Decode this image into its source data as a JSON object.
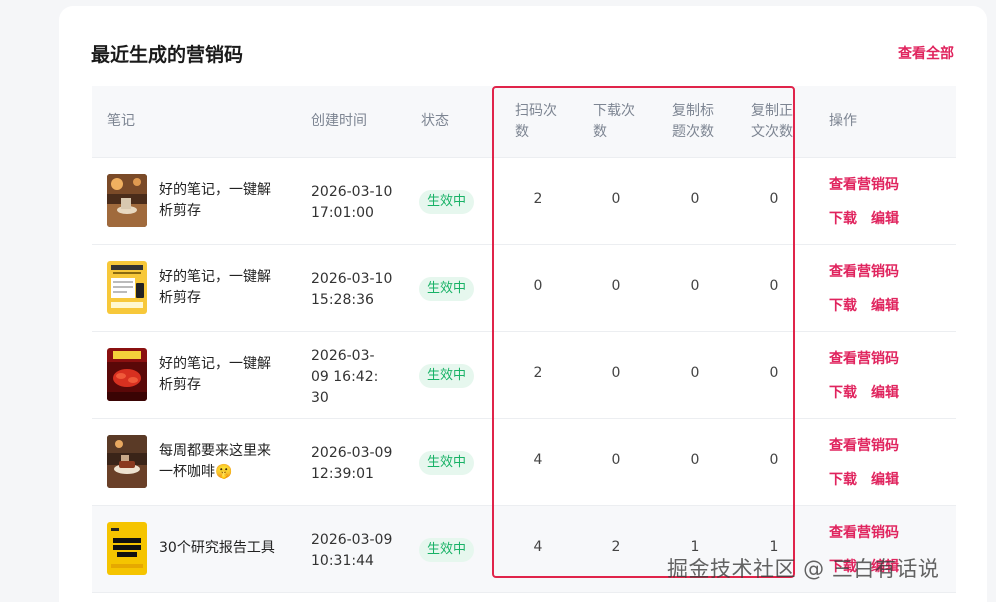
{
  "panel": {
    "title": "最近生成的营销码",
    "view_all": "查看全部"
  },
  "columns": {
    "note": "笔记",
    "created": "创建时间",
    "status": "状态",
    "scan": "扫码次数",
    "download": "下载次数",
    "copy_title": "复制标题次数",
    "copy_body": "复制正文次数",
    "action": "操作"
  },
  "rows": [
    {
      "note": "好的笔记，一键解析剪存",
      "created": "2026-03-10 17:01:00",
      "status": "生效中",
      "scan": "2",
      "download": "0",
      "copy_title": "0",
      "copy_body": "0",
      "thumb": "cafe-table-photo"
    },
    {
      "note": "好的笔记，一键解析剪存",
      "created": "2026-03-10 15:28:36",
      "status": "生效中",
      "scan": "0",
      "download": "0",
      "copy_title": "0",
      "copy_body": "0",
      "thumb": "yellow-tool-cover"
    },
    {
      "note": "好的笔记，一键解析剪存",
      "created": "2026-03-09 16:42:30",
      "status": "生效中",
      "scan": "2",
      "download": "0",
      "copy_title": "0",
      "copy_body": "0",
      "thumb": "red-crayfish-poster"
    },
    {
      "note": "每周都要来这里来一杯咖啡🤫",
      "created": "2026-03-09 12:39:01",
      "status": "生效中",
      "scan": "4",
      "download": "0",
      "copy_title": "0",
      "copy_body": "0",
      "thumb": "coffee-dessert-photo"
    },
    {
      "note": "30个研究报告工具",
      "created": "2026-03-09 10:31:44",
      "status": "生效中",
      "scan": "4",
      "download": "2",
      "copy_title": "1",
      "copy_body": "1",
      "thumb": "yellow-report-cover"
    }
  ],
  "actions": {
    "view_code": "查看营销码",
    "download": "下载",
    "edit": "编辑"
  },
  "watermark": "掘金技术社区 @ 三白有话说",
  "colors": {
    "accent": "#e0245e",
    "status_text": "#18b266",
    "status_bg": "#e6f7ee",
    "highlight": "#e0244a"
  }
}
